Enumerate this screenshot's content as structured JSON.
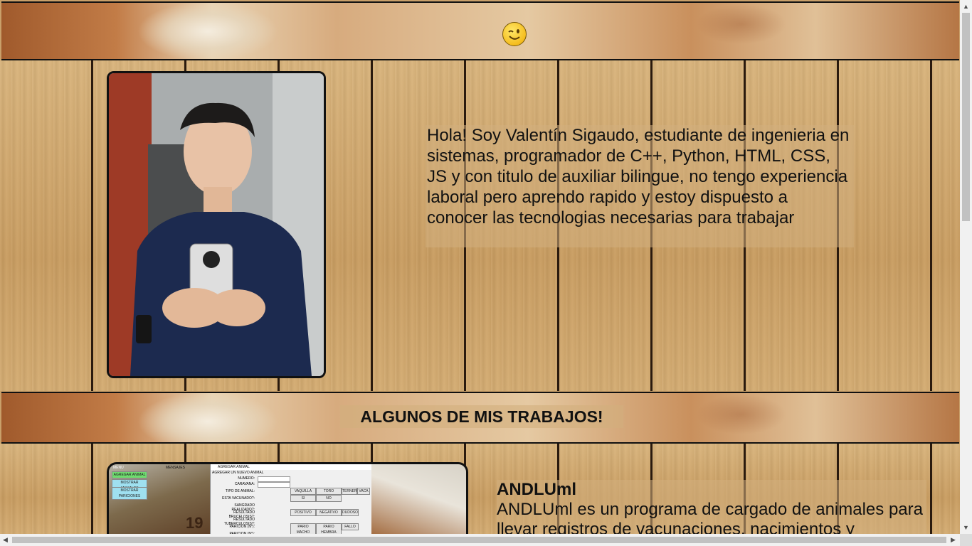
{
  "header": {
    "emoji": "winking-face"
  },
  "bio": {
    "text": "Hola! Soy Valentín Sigaudo, estudiante de ingenieria en sistemas, programador de C++, Python, HTML, CSS, JS y con titulo de auxiliar bilingue, no tengo experiencia laboral pero aprendo rapido y estoy dispuesto a conocer las tecnologias necesarias para trabajar"
  },
  "works": {
    "title": "ALGUNOS DE MIS TRABAJOS!"
  },
  "project": {
    "name": "ANDLUml",
    "description": "ANDLUml es un programa de cargado de animales para llevar registros de vacunaciones, nacimientos y",
    "screenshot": {
      "menu_label": "MENU",
      "messages_label": "MENSAJES",
      "buttons": [
        "AGREGAR ANIMAL",
        "MOSTRAR ANIMALES",
        "MOSTRAR PARICIONES"
      ],
      "dialog_title": "AGREGAR ANIMAL",
      "dialog_heading": "AGREGAR UN NUEVO ANIMAL",
      "fields": [
        "NUMERO:",
        "CARAVANA:",
        "TIPO DE ANIMAL:",
        "ESTA VACUNADO?:",
        "SANGRADO REALIZADO?:",
        "RESULTADO BRUCELOSIS?:",
        "RESULTADO TUBERCULOSIS?:",
        "PARICION (N°):",
        "PARICION (N°):"
      ],
      "options": [
        "VAQUILLA",
        "TORO",
        "TERNERO",
        "VACA",
        "SI",
        "NO",
        "POSITIVO",
        "NEGATIVO",
        "DUDOSO",
        "PARIO MACHO",
        "PARIO HEMBRA",
        "FALLO"
      ],
      "ear_tag": "19"
    }
  },
  "colors": {
    "wood": "#c99d61",
    "panel": "#d2af7d",
    "frame": "#111111"
  }
}
